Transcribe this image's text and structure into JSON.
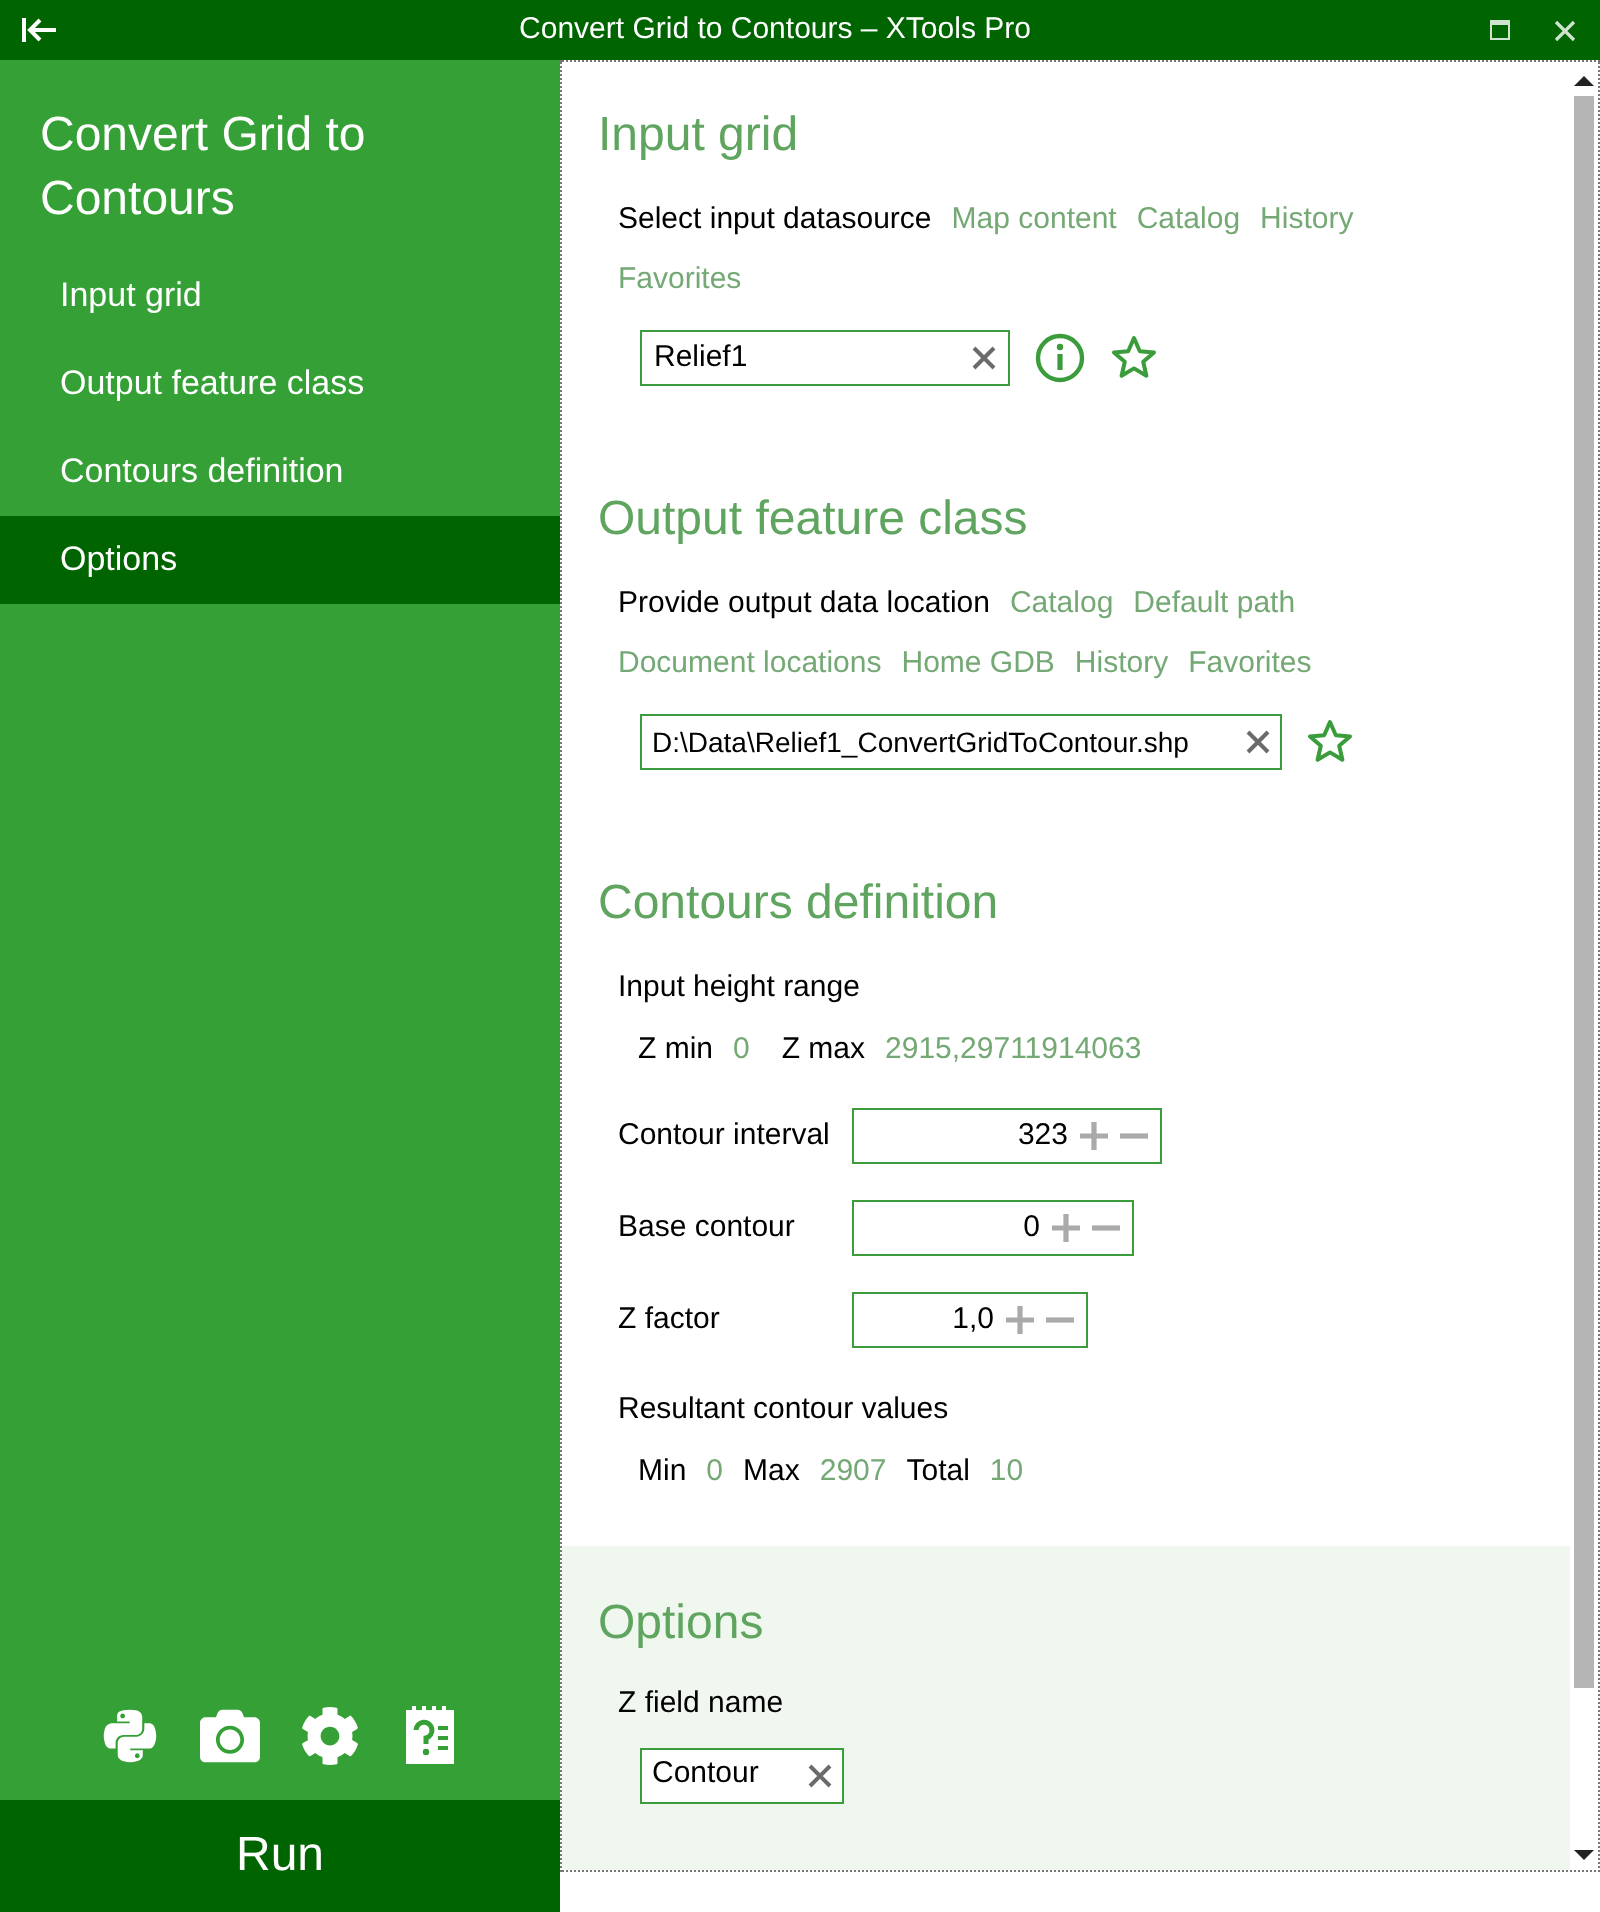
{
  "window": {
    "title": "Convert Grid to Contours – XTools Pro"
  },
  "sidebar": {
    "title": "Convert Grid to Contours",
    "items": [
      {
        "label": "Input grid",
        "selected": false
      },
      {
        "label": "Output feature class",
        "selected": false
      },
      {
        "label": "Contours definition",
        "selected": false
      },
      {
        "label": "Options",
        "selected": true
      }
    ],
    "run_button": "Run"
  },
  "input_grid": {
    "heading": "Input grid",
    "prompt": "Select input datasource",
    "links": [
      "Map content",
      "Catalog",
      "History",
      "Favorites"
    ],
    "field": {
      "value": "Relief1"
    }
  },
  "output_feature_class": {
    "heading": "Output feature class",
    "prompt": "Provide output data location",
    "links": [
      "Catalog",
      "Default path",
      "Document locations",
      "Home GDB",
      "History",
      "Favorites"
    ],
    "field": {
      "value": "D:\\Data\\Relief1_ConvertGridToContour.shp"
    }
  },
  "contours_definition": {
    "heading": "Contours definition",
    "height_range_label": "Input height range",
    "height_range": [
      {
        "label": "Z min",
        "value": "0"
      },
      {
        "label": "Z max",
        "value": "2915,29711914063"
      }
    ],
    "steppers": [
      {
        "label": "Contour interval",
        "value": "323"
      },
      {
        "label": "Base contour",
        "value": "0"
      },
      {
        "label": "Z factor",
        "value": "1,0"
      }
    ],
    "result_label": "Resultant contour values",
    "results": [
      {
        "label": "Min",
        "value": "0"
      },
      {
        "label": "Max",
        "value": "2907"
      },
      {
        "label": "Total",
        "value": "10"
      }
    ]
  },
  "options": {
    "heading": "Options",
    "field_label": "Z field name",
    "field": {
      "value": "Contour"
    }
  }
}
